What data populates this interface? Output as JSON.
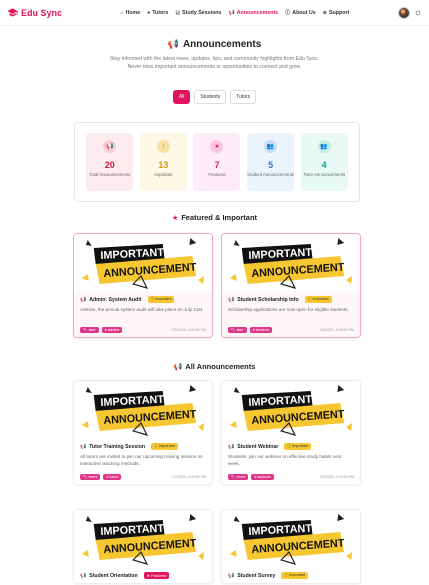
{
  "brand": {
    "name": "Edu Sync"
  },
  "nav": {
    "items": [
      {
        "label": "Home",
        "icon": "home-icon"
      },
      {
        "label": "Tutors",
        "icon": "user-icon"
      },
      {
        "label": "Study Sessions",
        "icon": "book-icon"
      },
      {
        "label": "Announcements",
        "icon": "megaphone-icon",
        "active": true
      },
      {
        "label": "About Us",
        "icon": "info-icon"
      },
      {
        "label": "Support",
        "icon": "support-icon"
      }
    ]
  },
  "hero": {
    "title": "Announcements",
    "description": "Stay informed with the latest news, updates, tips, and community highlights from Edu Sync. Never miss important announcements or opportunities to connect and grow."
  },
  "filters": [
    "All",
    "Students",
    "Tutors"
  ],
  "stats": [
    {
      "value": "20",
      "label": "Total Announcements",
      "icon": "megaphone-icon"
    },
    {
      "value": "13",
      "label": "Important",
      "icon": "alert-icon"
    },
    {
      "value": "7",
      "label": "Featured",
      "icon": "star-icon"
    },
    {
      "value": "5",
      "label": "Student Announcements",
      "icon": "users-icon"
    },
    {
      "value": "4",
      "label": "Tutor Announcements",
      "icon": "users-icon"
    }
  ],
  "sections": {
    "featured": "Featured & Important",
    "all": "All Announcements"
  },
  "banner": {
    "line1": "IMPORTANT",
    "line2": "ANNOUNCEMENT"
  },
  "featured_cards": [
    {
      "title": "Admin: System Audit",
      "badge": "Important",
      "text": "Admins, the annual system audit will take place on July 21st.",
      "tags": [
        "alert",
        "admins"
      ],
      "date": "7/2/2025, 4:00:00 PM"
    },
    {
      "title": "Student Scholarship Info",
      "badge": "Important",
      "text": "Scholarship applications are now open for eligible students.",
      "tags": [
        "alert",
        "students"
      ],
      "date": "7/8/2025, 4:00:00 PM"
    }
  ],
  "all_cards": [
    {
      "title": "Tutor Training Session",
      "badge": "Important",
      "text": "All tutors are invited to join our upcoming training session on interactive teaching methods.",
      "tags": [
        "event",
        "tutors"
      ],
      "date": "7/7/2025, 4:00:00 PM"
    },
    {
      "title": "Student Webinar",
      "badge": "Important",
      "text": "Students, join our webinar on effective study habits next week.",
      "tags": [
        "event",
        "students"
      ],
      "date": "7/3/2025, 4:00:00 PM"
    },
    {
      "title": "Student Orientation",
      "badge": "Featured",
      "text": "",
      "tags": [],
      "date": ""
    },
    {
      "title": "Student Survey",
      "badge": "Important",
      "text": "",
      "tags": [],
      "date": ""
    }
  ],
  "colors": {
    "accent": "#e0145c",
    "banner_yellow": "#f7c731"
  }
}
